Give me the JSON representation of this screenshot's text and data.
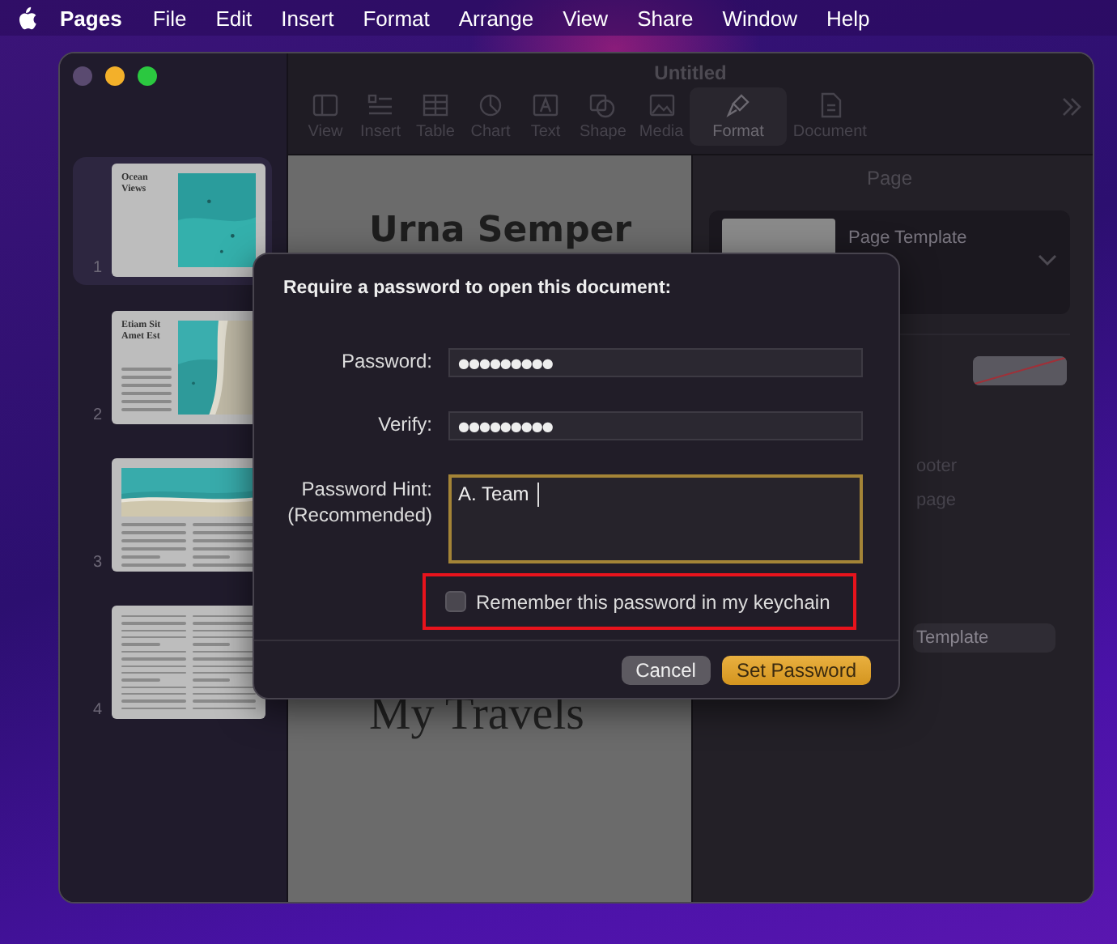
{
  "menu_bar": {
    "app": "Pages",
    "items": [
      "File",
      "Edit",
      "Insert",
      "Format",
      "Arrange",
      "View",
      "Share",
      "Window",
      "Help"
    ]
  },
  "window": {
    "title": "Untitled",
    "toolbar": [
      {
        "label": "View",
        "selected": false
      },
      {
        "label": "Insert",
        "selected": false
      },
      {
        "label": "Table",
        "selected": false
      },
      {
        "label": "Chart",
        "selected": false
      },
      {
        "label": "Text",
        "selected": false
      },
      {
        "label": "Shape",
        "selected": false
      },
      {
        "label": "Media",
        "selected": false
      },
      {
        "label": "Format",
        "selected": true
      },
      {
        "label": "Document",
        "selected": false
      }
    ]
  },
  "sidebar": {
    "pages": [
      {
        "number": "1",
        "selected": true,
        "kind": "cover",
        "title": "Ocean Views"
      },
      {
        "number": "2",
        "selected": false,
        "kind": "split",
        "title": "Etiam Sit Amet Est"
      },
      {
        "number": "3",
        "selected": false,
        "kind": "banner"
      },
      {
        "number": "4",
        "selected": false,
        "kind": "text"
      }
    ]
  },
  "document": {
    "heading": "Urna Semper",
    "subheading": "My Travels"
  },
  "inspector": {
    "title": "Page",
    "template_label": "Page Template",
    "fragments": [
      "ooter",
      "page"
    ],
    "button": "Template"
  },
  "dialog": {
    "title": "Require a password to open this document:",
    "fields": [
      {
        "label": "Password:",
        "value": "●●●●●●●●●"
      },
      {
        "label": "Verify:",
        "value": "●●●●●●●●●"
      }
    ],
    "hint": {
      "label": "Password Hint:",
      "sublabel": "(Recommended)",
      "value": "A. Team"
    },
    "keychain": {
      "label": "Remember this password in my keychain",
      "checked": false,
      "highlighted": true
    },
    "buttons": [
      {
        "label": "Cancel",
        "kind": "secondary"
      },
      {
        "label": "Set Password",
        "kind": "primary"
      }
    ]
  }
}
